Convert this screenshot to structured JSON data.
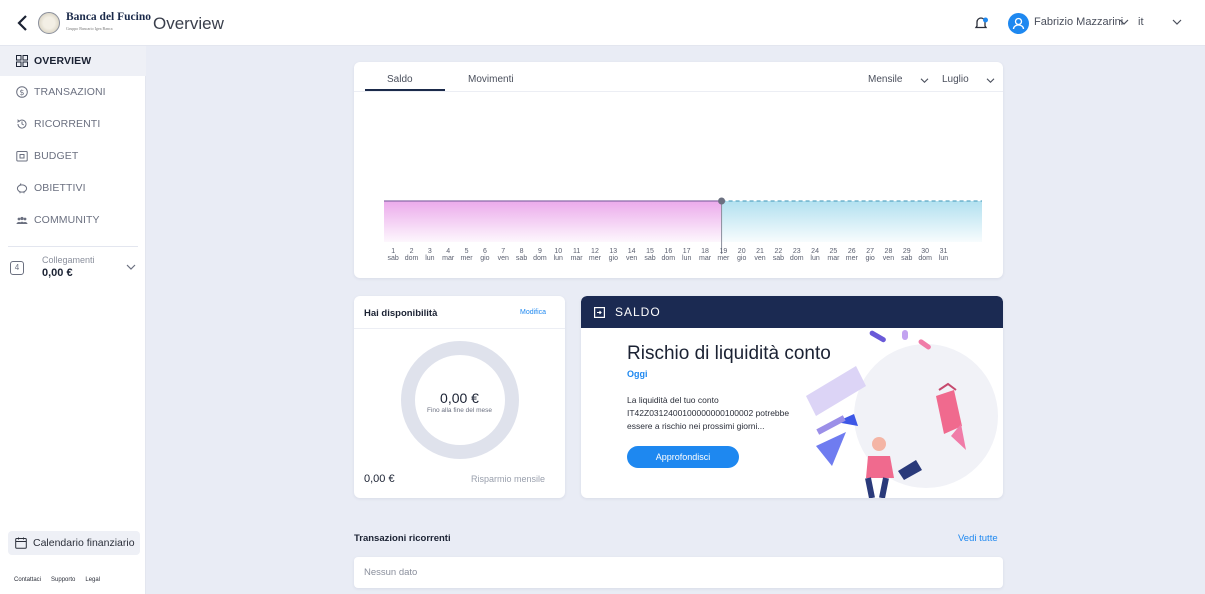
{
  "header": {
    "logo_text": "Banca del Fucino",
    "logo_sub": "Gruppo Bancario Igea Banca",
    "page_title": "Overview",
    "user_name": "Fabrizio Mazzarini",
    "language": "it"
  },
  "sidebar": {
    "items": [
      {
        "label": "OVERVIEW",
        "icon": "grid-icon",
        "active": true
      },
      {
        "label": "TRANSAZIONI",
        "icon": "dollar-circle-icon",
        "active": false
      },
      {
        "label": "RICORRENTI",
        "icon": "recurring-icon",
        "active": false
      },
      {
        "label": "BUDGET",
        "icon": "budget-icon",
        "active": false
      },
      {
        "label": "OBIETTIVI",
        "icon": "piggy-bank-icon",
        "active": false
      },
      {
        "label": "COMMUNITY",
        "icon": "community-icon",
        "active": false
      }
    ],
    "collegamenti": {
      "badge": "4",
      "label": "Collegamenti",
      "value": "0,00 €"
    },
    "calendar_button": "Calendario finanziario",
    "footer_links": [
      "Contattaci",
      "Supporto",
      "Legal"
    ]
  },
  "chart_card": {
    "tabs": [
      "Saldo",
      "Movimenti"
    ],
    "active_tab": "Saldo",
    "period_select": "Mensile",
    "month_select": "Luglio"
  },
  "chart_data": {
    "type": "area",
    "days": [
      "1",
      "2",
      "3",
      "4",
      "5",
      "6",
      "7",
      "8",
      "9",
      "10",
      "11",
      "12",
      "13",
      "14",
      "15",
      "16",
      "17",
      "18",
      "19",
      "20",
      "21",
      "22",
      "23",
      "24",
      "25",
      "26",
      "27",
      "28",
      "29",
      "30",
      "31"
    ],
    "weekdays": [
      "sab",
      "dom",
      "lun",
      "mar",
      "mer",
      "gio",
      "ven",
      "sab",
      "dom",
      "lun",
      "mar",
      "mer",
      "gio",
      "ven",
      "sab",
      "dom",
      "lun",
      "mar",
      "mer",
      "gio",
      "ven",
      "sab",
      "dom",
      "lun",
      "mar",
      "mer",
      "gio",
      "ven",
      "sab",
      "dom",
      "lun"
    ],
    "today_index": 17,
    "actual_color": "#e89be8",
    "forecast_color": "#9fd9ec"
  },
  "disponibilita": {
    "title": "Hai disponibilità",
    "edit_link": "Modifica",
    "amount": "0,00 €",
    "subtitle": "Fino alla fine del mese",
    "saving_amount": "0,00 €",
    "saving_label": "Risparmio mensile"
  },
  "saldo_alert": {
    "header": "SALDO",
    "title": "Rischio di liquidità conto",
    "date": "Oggi",
    "text_line1": "La liquidità del tuo conto",
    "text_line2": "IT42Z0312400100000000100002 potrebbe",
    "text_line3": "essere a rischio nei prossimi giorni...",
    "button": "Approfondisci"
  },
  "recurring": {
    "title": "Transazioni ricorrenti",
    "see_all": "Vedi tutte",
    "empty": "Nessun dato"
  },
  "colors": {
    "primary": "#1e88f0",
    "navy": "#1b2a52",
    "background": "#e9ecf5"
  }
}
